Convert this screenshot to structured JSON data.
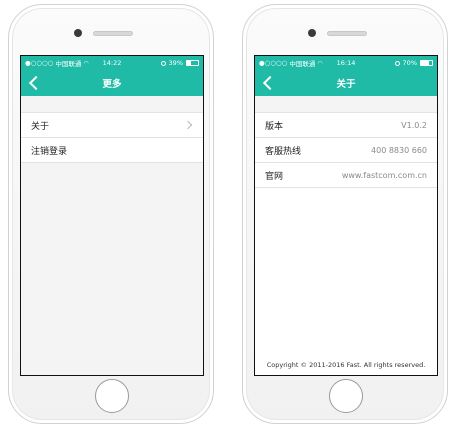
{
  "screens": [
    {
      "status": {
        "carrier": "中国联通",
        "time": "14:22",
        "battery": "39%",
        "battery_level": 0.39
      },
      "nav": {
        "title": "更多"
      },
      "items": [
        {
          "label": "关于"
        },
        {
          "label": "注销登录"
        }
      ]
    },
    {
      "status": {
        "carrier": "中国联通",
        "time": "16:14",
        "battery": "70%",
        "battery_level": 0.7
      },
      "nav": {
        "title": "关于"
      },
      "items": [
        {
          "label": "版本",
          "value": "V1.0.2"
        },
        {
          "label": "客服热线",
          "value": "400 8830 660"
        },
        {
          "label": "官网",
          "value": "www.fastcom.com.cn"
        }
      ],
      "footer": "Copyright © 2011-2016 Fast. All rights reserved."
    }
  ],
  "colors": {
    "accent": "#1fbba6",
    "background": "#f4f4f4"
  },
  "icons": {
    "signal": "signal-dots-icon",
    "wifi": "wifi-icon",
    "alarm": "alarm-icon",
    "battery": "battery-icon",
    "back": "back-chevron-icon",
    "disclosure": "chevron-right-icon"
  }
}
